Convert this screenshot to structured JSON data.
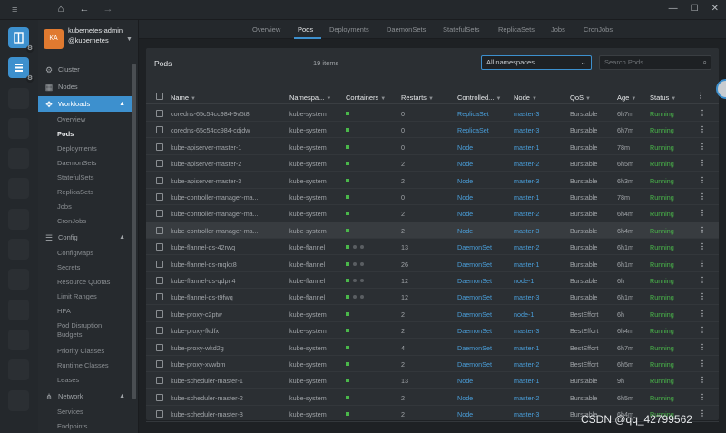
{
  "titlebar": {
    "menu": "≡",
    "home": "⌂",
    "back": "←",
    "forward": "→",
    "minimize": "—",
    "maximize": "☐",
    "close": "✕"
  },
  "cluster": {
    "initials": "KA",
    "name": "kubernetes-admin@kubernetes"
  },
  "sidebar": {
    "cluster": "Cluster",
    "nodes": "Nodes",
    "workloads": "Workloads",
    "workload_items": [
      "Overview",
      "Pods",
      "Deployments",
      "DaemonSets",
      "StatefulSets",
      "ReplicaSets",
      "Jobs",
      "CronJobs"
    ],
    "config": "Config",
    "config_items": [
      "ConfigMaps",
      "Secrets",
      "Resource Quotas",
      "Limit Ranges",
      "HPA",
      "Pod Disruption Budgets",
      "Priority Classes",
      "Runtime Classes",
      "Leases"
    ],
    "network": "Network",
    "network_items": [
      "Services",
      "Endpoints"
    ]
  },
  "tabs": [
    "Overview",
    "Pods",
    "Deployments",
    "DaemonSets",
    "StatefulSets",
    "ReplicaSets",
    "Jobs",
    "CronJobs"
  ],
  "panel": {
    "title": "Pods",
    "count": "19 items",
    "namespace_value": "All namespaces",
    "search_placeholder": "Search Pods..."
  },
  "columns": [
    "Name",
    "Namespa...",
    "Containers",
    "Restarts",
    "Controlled...",
    "Node",
    "QoS",
    "Age",
    "Status"
  ],
  "pods": [
    {
      "name": "coredns-65c54cc984-9v5t8",
      "ns": "kube-system",
      "containers": "g",
      "restarts": "0",
      "ctrl": "ReplicaSet",
      "node": "master-3",
      "qos": "Burstable",
      "age": "6h7m",
      "status": "Running"
    },
    {
      "name": "coredns-65c54cc984-cdjdw",
      "ns": "kube-system",
      "containers": "g",
      "restarts": "0",
      "ctrl": "ReplicaSet",
      "node": "master-3",
      "qos": "Burstable",
      "age": "6h7m",
      "status": "Running"
    },
    {
      "name": "kube-apiserver-master-1",
      "ns": "kube-system",
      "containers": "g",
      "restarts": "0",
      "ctrl": "Node",
      "node": "master-1",
      "qos": "Burstable",
      "age": "78m",
      "status": "Running"
    },
    {
      "name": "kube-apiserver-master-2",
      "ns": "kube-system",
      "containers": "g",
      "restarts": "2",
      "ctrl": "Node",
      "node": "master-2",
      "qos": "Burstable",
      "age": "6h5m",
      "status": "Running"
    },
    {
      "name": "kube-apiserver-master-3",
      "ns": "kube-system",
      "containers": "g",
      "restarts": "2",
      "ctrl": "Node",
      "node": "master-3",
      "qos": "Burstable",
      "age": "6h3m",
      "status": "Running"
    },
    {
      "name": "kube-controller-manager-ma...",
      "ns": "kube-system",
      "containers": "g",
      "restarts": "0",
      "ctrl": "Node",
      "node": "master-1",
      "qos": "Burstable",
      "age": "78m",
      "status": "Running"
    },
    {
      "name": "kube-controller-manager-ma...",
      "ns": "kube-system",
      "containers": "g",
      "restarts": "2",
      "ctrl": "Node",
      "node": "master-2",
      "qos": "Burstable",
      "age": "6h4m",
      "status": "Running"
    },
    {
      "name": "kube-controller-manager-ma...",
      "ns": "kube-system",
      "containers": "g",
      "restarts": "2",
      "ctrl": "Node",
      "node": "master-3",
      "qos": "Burstable",
      "age": "6h4m",
      "status": "Running"
    },
    {
      "name": "kube-flannel-ds-42rwq",
      "ns": "kube-flannel",
      "containers": "gxx",
      "restarts": "13",
      "ctrl": "DaemonSet",
      "node": "master-2",
      "qos": "Burstable",
      "age": "6h1m",
      "status": "Running"
    },
    {
      "name": "kube-flannel-ds-mqkx8",
      "ns": "kube-flannel",
      "containers": "gxx",
      "restarts": "26",
      "ctrl": "DaemonSet",
      "node": "master-1",
      "qos": "Burstable",
      "age": "6h1m",
      "status": "Running"
    },
    {
      "name": "kube-flannel-ds-qdpn4",
      "ns": "kube-flannel",
      "containers": "gxx",
      "restarts": "12",
      "ctrl": "DaemonSet",
      "node": "node-1",
      "qos": "Burstable",
      "age": "6h",
      "status": "Running"
    },
    {
      "name": "kube-flannel-ds-t9fwq",
      "ns": "kube-flannel",
      "containers": "gxx",
      "restarts": "12",
      "ctrl": "DaemonSet",
      "node": "master-3",
      "qos": "Burstable",
      "age": "6h1m",
      "status": "Running"
    },
    {
      "name": "kube-proxy-c2ptw",
      "ns": "kube-system",
      "containers": "g",
      "restarts": "2",
      "ctrl": "DaemonSet",
      "node": "node-1",
      "qos": "BestEffort",
      "age": "6h",
      "status": "Running"
    },
    {
      "name": "kube-proxy-fkdfx",
      "ns": "kube-system",
      "containers": "g",
      "restarts": "2",
      "ctrl": "DaemonSet",
      "node": "master-3",
      "qos": "BestEffort",
      "age": "6h4m",
      "status": "Running"
    },
    {
      "name": "kube-proxy-wkd2g",
      "ns": "kube-system",
      "containers": "g",
      "restarts": "4",
      "ctrl": "DaemonSet",
      "node": "master-1",
      "qos": "BestEffort",
      "age": "6h7m",
      "status": "Running"
    },
    {
      "name": "kube-proxy-xvwbm",
      "ns": "kube-system",
      "containers": "g",
      "restarts": "2",
      "ctrl": "DaemonSet",
      "node": "master-2",
      "qos": "BestEffort",
      "age": "6h5m",
      "status": "Running"
    },
    {
      "name": "kube-scheduler-master-1",
      "ns": "kube-system",
      "containers": "g",
      "restarts": "13",
      "ctrl": "Node",
      "node": "master-1",
      "qos": "Burstable",
      "age": "9h",
      "status": "Running"
    },
    {
      "name": "kube-scheduler-master-2",
      "ns": "kube-system",
      "containers": "g",
      "restarts": "2",
      "ctrl": "Node",
      "node": "master-2",
      "qos": "Burstable",
      "age": "6h5m",
      "status": "Running"
    },
    {
      "name": "kube-scheduler-master-3",
      "ns": "kube-system",
      "containers": "g",
      "restarts": "2",
      "ctrl": "Node",
      "node": "master-3",
      "qos": "Burstable",
      "age": "6h4m",
      "status": "Running"
    }
  ],
  "highlighted_row": 7,
  "colors": {
    "accent": "#3d90ce",
    "link": "#4a9fdb",
    "running": "#4ab84a",
    "avatar": "#e07a30"
  },
  "watermark": "CSDN @qq_42799562"
}
